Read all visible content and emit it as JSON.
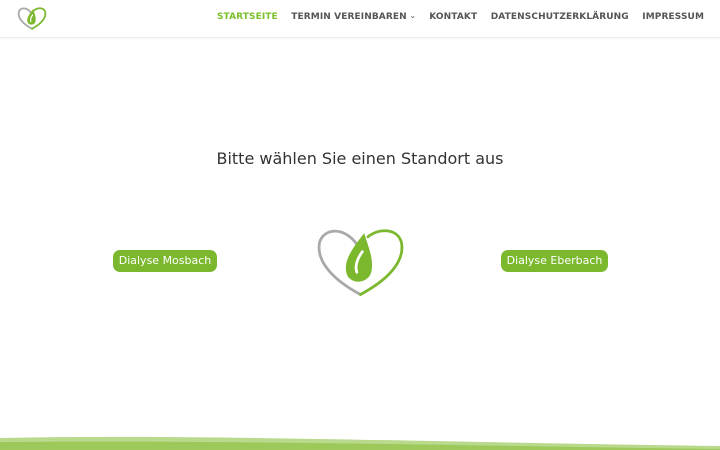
{
  "colors": {
    "accent": "#7bb82e",
    "nav_text": "#555555",
    "logo_gray": "#a9a9a9"
  },
  "header": {
    "logo_icon": "heart-leaf-logo",
    "nav": [
      {
        "label": "STARTSEITE",
        "active": true
      },
      {
        "label": "TERMIN VEREINBAREN",
        "has_dropdown": true
      },
      {
        "label": "KONTAKT"
      },
      {
        "label": "DATENSCHUTZERKLÄRUNG"
      },
      {
        "label": "IMPRESSUM"
      }
    ]
  },
  "main": {
    "headline": "Bitte wählen Sie einen Standort aus",
    "left_button": "Dialyse Mosbach",
    "right_button": "Dialyse Eberbach",
    "center_logo_icon": "heart-leaf-logo"
  }
}
